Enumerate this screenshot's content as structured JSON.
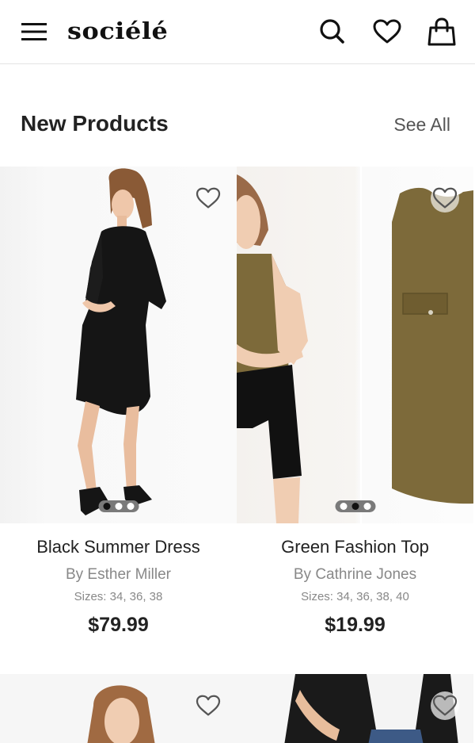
{
  "header": {
    "logo": "sociélé",
    "menu_icon": "hamburger-menu-icon",
    "search_icon": "search-icon",
    "favorites_icon": "heart-icon",
    "bag_icon": "shopping-bag-icon"
  },
  "section": {
    "title": "New Products",
    "see_all": "See All"
  },
  "products": [
    {
      "name": "Black Summer Dress",
      "brand": "By Esther Miller",
      "sizes": "Sizes: 34, 36, 38",
      "price": "$79.99",
      "image_count": 3,
      "active_image": 1
    },
    {
      "name": "Green Fashion Top",
      "brand": "By Cathrine Jones",
      "sizes": "Sizes: 34, 36, 38, 40",
      "price": "$19.99",
      "image_count": 3,
      "active_image": 2
    },
    {
      "name": "",
      "brand": "",
      "sizes": "",
      "price": ""
    },
    {
      "name": "",
      "brand": "",
      "sizes": "",
      "price": ""
    }
  ],
  "colors": {
    "text": "#222222",
    "muted": "#888888",
    "dress_black": "#151515",
    "top_olive": "#7d6a3a"
  }
}
